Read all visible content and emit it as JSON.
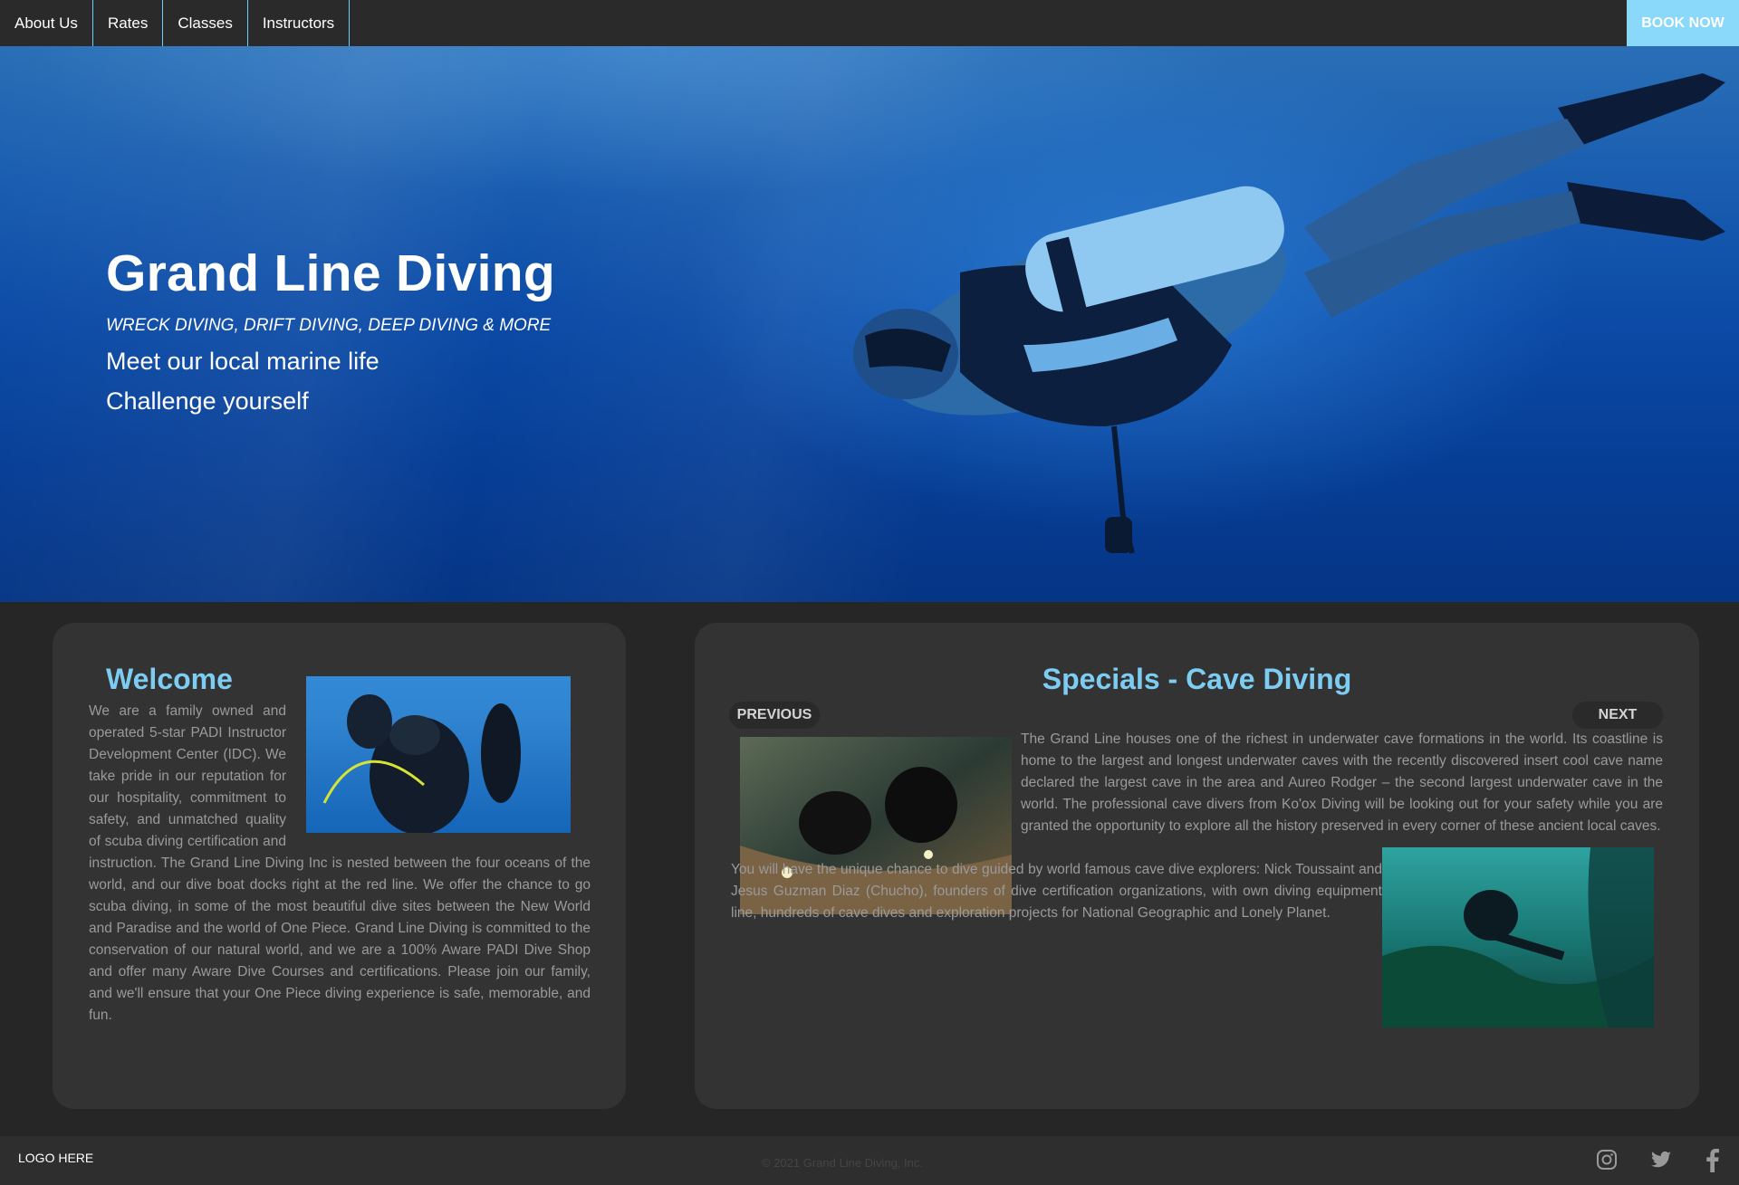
{
  "nav": {
    "items": [
      {
        "label": "About Us"
      },
      {
        "label": "Rates"
      },
      {
        "label": "Classes"
      },
      {
        "label": "Instructors"
      }
    ],
    "book_now": "BOOK NOW"
  },
  "hero": {
    "title": "Grand Line Diving",
    "tagline": "WRECK DIVING, DRIFT DIVING, DEEP DIVING & MORE",
    "lines": [
      "Meet our local marine life",
      "Challenge yourself"
    ]
  },
  "welcome": {
    "heading": "Welcome",
    "text": "We are a family owned and operated 5-star PADI Instructor Development Center (IDC). We take pride in our reputation for our hospitality, commitment to safety, and unmatched quality of scuba diving certification and instruction. The Grand Line Diving Inc is nested between the four oceans of the world, and our dive boat docks right at the red line. We offer the chance to go scuba diving, in some of the most beautiful dive sites between the New World and Paradise and the world of One Piece. Grand Line Diving is committed to the conservation of our natural world, and we are a 100% Aware PADI Dive Shop and offer many Aware Dive Courses and certifications. Please join our family, and we'll ensure that your One Piece diving experience is safe, memorable, and fun."
  },
  "specials": {
    "heading": "Specials - Cave Diving",
    "previous": "PREVIOUS",
    "next": "NEXT",
    "para1": "The Grand Line houses one of the richest in underwater cave formations in the world. Its coastline is home to the largest and longest underwater caves with the recently discovered insert cool cave name declared the largest cave in the area and Aureo Rodger – the second largest underwater cave in the world. The professional cave divers from Ko'ox Diving will be looking out for your safety while you are granted the opportunity to explore all the history preserved in every corner of these ancient local caves.",
    "para2": "You will have the unique chance to dive guided by world famous cave dive explorers: Nick Toussaint and Jesus Guzman Diaz (Chucho), founders of dive certification organizations, with own diving equipment line, hundreds of cave dives and exploration projects for National Geographic and Lonely Planet."
  },
  "footer": {
    "logo": "LOGO HERE",
    "copyright": "© 2021 Grand Line Diving, Inc.",
    "social": [
      "instagram-icon",
      "twitter-icon",
      "facebook-icon"
    ]
  },
  "colors": {
    "accent": "#7dcdf3",
    "book_now_bg": "#8ad8fa",
    "nav_bg": "#2a2a2a",
    "page_bg": "#262626",
    "panel_bg": "#333333"
  }
}
